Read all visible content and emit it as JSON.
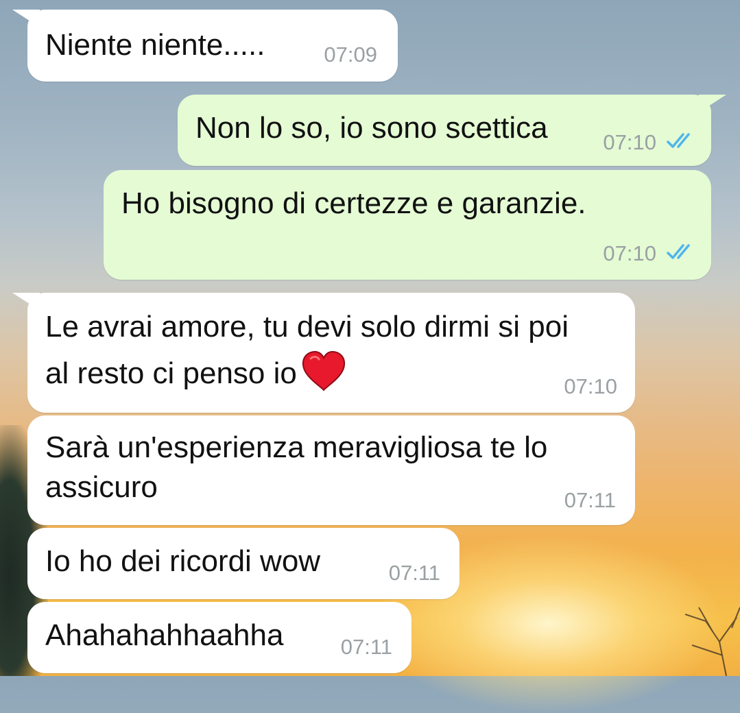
{
  "colors": {
    "incoming_bubble": "#ffffff",
    "outgoing_bubble": "#e4fbd4",
    "timestamp": "#9aa0a3",
    "read_ticks": "#4fb6ec",
    "heart": "#e8192c"
  },
  "messages": [
    {
      "direction": "incoming",
      "lines": [
        "Niente niente....."
      ],
      "time": "07:09"
    },
    {
      "direction": "outgoing",
      "lines": [
        "Non lo so, io sono scettica"
      ],
      "time": "07:10",
      "status_icon": "double-check-icon"
    },
    {
      "direction": "outgoing",
      "lines": [
        "Ho bisogno di certezze e garanzie."
      ],
      "time": "07:10",
      "status_icon": "double-check-icon"
    },
    {
      "direction": "incoming",
      "lines": [
        "Le avrai amore, tu devi solo dirmi si poi",
        "al resto ci penso io"
      ],
      "emoji": "heart-icon",
      "time": "07:10"
    },
    {
      "direction": "incoming",
      "lines": [
        "Sarà un'esperienza meravigliosa te lo",
        "assicuro"
      ],
      "time": "07:11"
    },
    {
      "direction": "incoming",
      "lines": [
        "Io ho dei ricordi wow"
      ],
      "time": "07:11"
    },
    {
      "direction": "incoming",
      "lines": [
        "Ahahahahhaahha"
      ],
      "time": "07:11"
    }
  ]
}
